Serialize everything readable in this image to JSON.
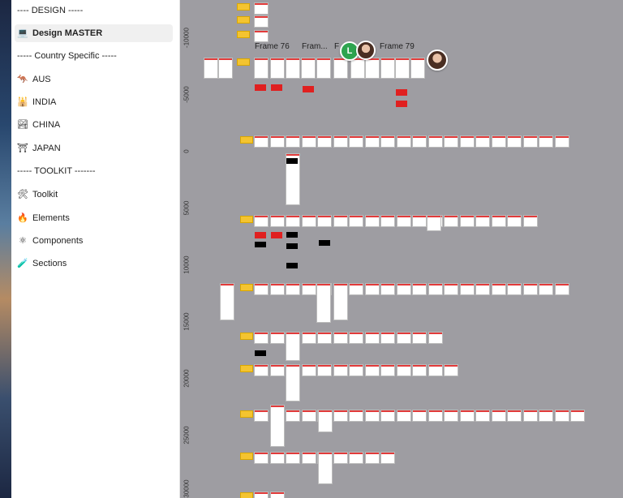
{
  "sidebar": {
    "items": [
      {
        "label": "---- DESIGN -----",
        "icon": ""
      },
      {
        "label": "Design MASTER",
        "icon": "laptop-icon",
        "glyph": "💻",
        "active": true
      },
      {
        "label": "----- Country Specific -----",
        "icon": ""
      },
      {
        "label": "AUS",
        "icon": "kangaroo-icon",
        "glyph": "🦘"
      },
      {
        "label": "INDIA",
        "icon": "india-flag-icon",
        "glyph": "🕌"
      },
      {
        "label": "CHINA",
        "icon": "landscape-icon",
        "glyph": "🏞"
      },
      {
        "label": "JAPAN",
        "icon": "torii-gate-icon",
        "glyph": "⛩"
      },
      {
        "label": "----- TOOLKIT -------",
        "icon": ""
      },
      {
        "label": "Toolkit",
        "icon": "tools-icon",
        "glyph": "🛠"
      },
      {
        "label": "Elements",
        "icon": "fire-icon",
        "glyph": "🔥"
      },
      {
        "label": "Components",
        "icon": "atom-icon",
        "glyph": "⚛"
      },
      {
        "label": "Sections",
        "icon": "test-tube-icon",
        "glyph": "🧪"
      }
    ]
  },
  "canvas": {
    "ruler_ticks": [
      "-10000",
      "-5000",
      "0",
      "5000",
      "10000",
      "15000",
      "20000",
      "25000",
      "30000"
    ],
    "frame_titles": [
      "Frame 76",
      "Fram...",
      "F",
      "Frame 79"
    ],
    "collaborators": [
      {
        "initial": "L",
        "color": "#2ea44f"
      }
    ]
  }
}
